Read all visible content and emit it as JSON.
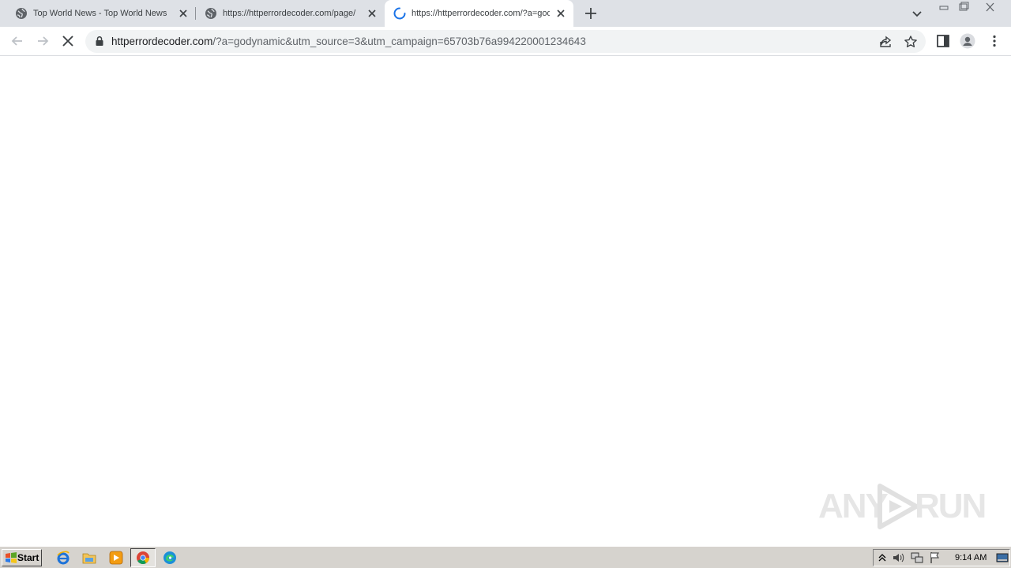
{
  "browser": {
    "tabs": [
      {
        "title": "Top World News - Top World News",
        "favicon": "globe-icon",
        "active": false,
        "loading": false
      },
      {
        "title": "https://httperrordecoder.com/page/",
        "favicon": "globe-icon",
        "active": false,
        "loading": false
      },
      {
        "title": "https://httperrordecoder.com/?a=godynamic",
        "favicon": "loading-spinner-icon",
        "active": true,
        "loading": true
      }
    ],
    "address_bar": {
      "host": "httperrordecoder.com",
      "path": "/?a=godynamic&utm_source=3&utm_campaign=65703b76a994220001234643"
    },
    "colors": {
      "tabstrip": "#dee1e6",
      "omnibox": "#f1f3f4",
      "spinner": "#1a73e8"
    }
  },
  "watermark": {
    "text_left": "ANY",
    "text_right": "RUN"
  },
  "taskbar": {
    "start_label": "Start",
    "quick_launch": [
      "internet-explorer-icon",
      "file-explorer-icon",
      "media-player-icon",
      "chrome-icon",
      "edge-icon"
    ],
    "clock": "9:14 AM"
  }
}
